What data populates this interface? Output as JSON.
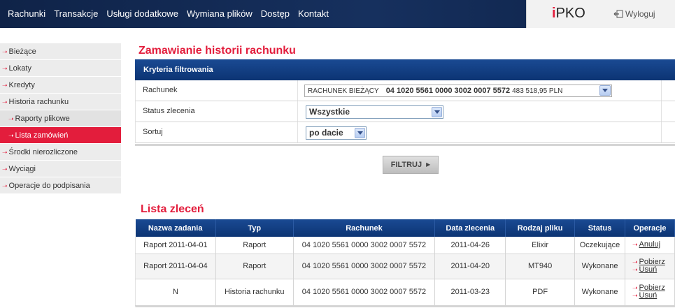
{
  "topnav": {
    "items": [
      "Rachunki",
      "Transakcje",
      "Usługi dodatkowe",
      "Wymiana plików",
      "Dostęp",
      "Kontakt"
    ]
  },
  "brand": {
    "logo_i": "i",
    "logo_text": "PKO",
    "logout_label": "Wyloguj"
  },
  "sidebar": {
    "items": [
      {
        "label": "Bieżące"
      },
      {
        "label": "Lokaty"
      },
      {
        "label": "Kredyty"
      },
      {
        "label": "Historia rachunku"
      },
      {
        "label": "Raporty plikowe"
      },
      {
        "label": "Lista zamówień"
      },
      {
        "label": "Środki nierozliczone"
      },
      {
        "label": "Wyciągi"
      },
      {
        "label": "Operacje do podpisania"
      }
    ]
  },
  "page_title": "Zamawianie historii rachunku",
  "filter": {
    "header": "Kryteria filtrowania",
    "account_label": "Rachunek",
    "account_name": "RACHUNEK BIEŻĄCY",
    "account_number": "04 1020 5561 0000 3002 0007 5572",
    "account_balance": "483 518,95 PLN",
    "status_label": "Status zlecenia",
    "status_value": "Wszystkie",
    "sort_label": "Sortuj",
    "sort_value": "po dacie",
    "button_label": "FILTRUJ"
  },
  "orders_title": "Lista zleceń",
  "orders": {
    "columns": [
      "Nazwa zadania",
      "Typ",
      "Rachunek",
      "Data zlecenia",
      "Rodzaj pliku",
      "Status",
      "Operacje"
    ],
    "rows": [
      {
        "name": "Raport 2011-04-01",
        "type": "Raport",
        "account": "04 1020 5561 0000 3002 0007 5572",
        "date": "2011-04-26",
        "file": "Elixir",
        "status": "Oczekujące",
        "op1": "Anuluj"
      },
      {
        "name": "Raport 2011-04-04",
        "type": "Raport",
        "account": "04 1020 5561 0000 3002 0007 5572",
        "date": "2011-04-20",
        "file": "MT940",
        "status": "Wykonane",
        "op1": "Pobierz",
        "op2": "Usuń"
      },
      {
        "name": "N",
        "type": "Historia rachunku",
        "account": "04 1020 5561 0000 3002 0007 5572",
        "date": "2011-03-23",
        "file": "PDF",
        "status": "Wykonane",
        "op1": "Pobierz",
        "op2": "Usuń"
      }
    ]
  },
  "colors": {
    "accent_red": "#e31d3c",
    "nav_blue": "#0f2348",
    "header_blue": "#0c3473"
  }
}
